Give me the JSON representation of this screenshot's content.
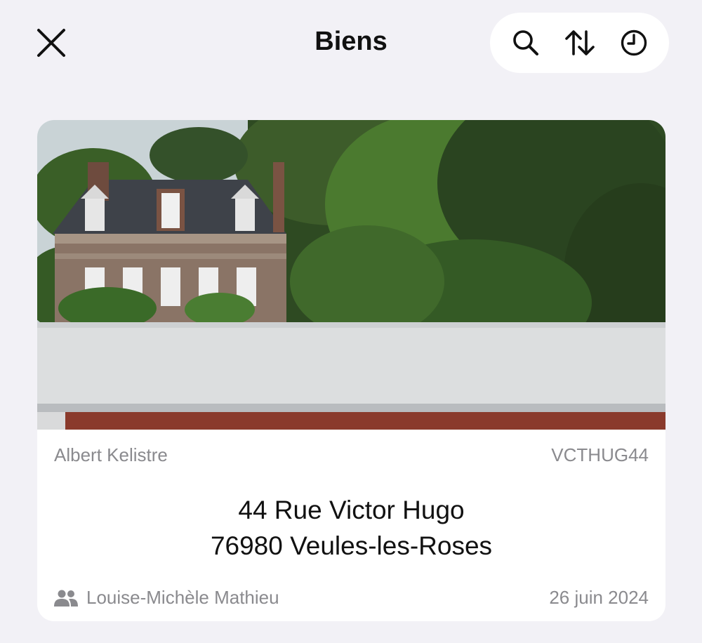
{
  "header": {
    "title": "Biens",
    "close_icon": "close-icon",
    "actions": [
      {
        "icon": "search-icon"
      },
      {
        "icon": "sort-arrows-icon"
      },
      {
        "icon": "history-clock-icon"
      }
    ]
  },
  "property_card": {
    "owner": "Albert Kelistre",
    "reference": "VCTHUG44",
    "address_line1": "44 Rue Victor Hugo",
    "address_line2": "76980 Veules-les-Roses",
    "contact_icon": "people-icon",
    "contact_name": "Louise-Michèle Mathieu",
    "date": "26 juin 2024"
  },
  "colors": {
    "background": "#f2f1f6",
    "card": "#ffffff",
    "secondary_text": "#8a8a8e",
    "primary_text": "#111111"
  }
}
